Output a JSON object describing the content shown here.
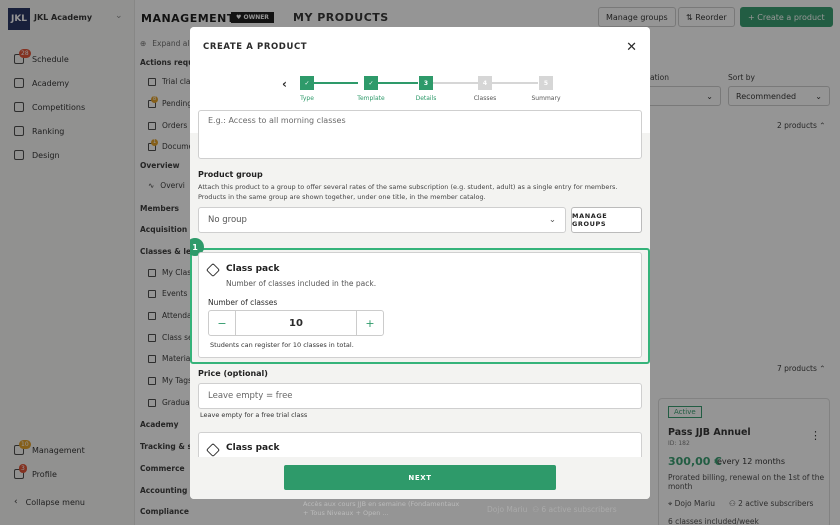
{
  "app": {
    "logo": "JKL",
    "org_name": "JKL Academy"
  },
  "rail": {
    "items": [
      {
        "label": "Schedule",
        "badge": "28"
      },
      {
        "label": "Academy"
      },
      {
        "label": "Competitions"
      },
      {
        "label": "Ranking"
      },
      {
        "label": "Design"
      }
    ],
    "bottom": [
      {
        "label": "Management",
        "badge": "10"
      },
      {
        "label": "Profile",
        "badge": "3"
      },
      {
        "label": "Collapse menu"
      }
    ]
  },
  "col2": {
    "title": "MANAGEMENT",
    "expand": "Expand all",
    "sections": {
      "actions": "Actions requir",
      "overview": "Overview",
      "members": "Members",
      "acquisition": "Acquisition",
      "classes": "Classes & le",
      "academy": "Academy",
      "tracking": "Tracking & st",
      "commerce": "Commerce",
      "accounting": "Accounting &",
      "compliance": "Compliance"
    },
    "actions_items": [
      "Trial cla",
      "Pending",
      "Orders",
      "Docume"
    ],
    "actions_badges": [
      "",
      "8",
      "",
      "1"
    ],
    "overview_items": [
      "Overvi"
    ],
    "classes_items": [
      "My Clas",
      "Events",
      "Attenda",
      "Class se",
      "Materia",
      "My Tags",
      "Gradua"
    ]
  },
  "header": {
    "owner_badge": "OWNER",
    "title": "MY PRODUCTS",
    "manage_groups": "Manage groups",
    "reorder": "Reorder",
    "create_product": "+ Create a product"
  },
  "background": {
    "sort_label": "Sort by",
    "sort_value": "Recommended",
    "filter_label": "ation",
    "products_count_1": "2 products",
    "products_count_2": "7 products",
    "active_badge": "Active",
    "product_name": "Pass JJB Annuel",
    "product_id": "ID: 182",
    "price": "300,00 €",
    "price_period": "every 12 months",
    "billing_note": "Prorated billing, renewal on the 1st of the month",
    "location": "Dojo Mariu",
    "subscribers": "2 active subscribers",
    "classes_included": "6 classes included/week",
    "left_card_text": "Accès aux cours JJB en semaine (Fondamentaux + Tous Niveaux + Open ...",
    "left_card_loc": "Dojo Mariu",
    "left_card_subs": "6 active subscribers"
  },
  "modal": {
    "title": "CREATE A PRODUCT",
    "steps": [
      {
        "label": "Type",
        "state": "done",
        "num": "✓"
      },
      {
        "label": "Template",
        "state": "done",
        "num": "✓"
      },
      {
        "label": "Details",
        "state": "current",
        "num": "3"
      },
      {
        "label": "Classes",
        "state": "todo",
        "num": "4"
      },
      {
        "label": "Summary",
        "state": "todo",
        "num": "5"
      }
    ],
    "description_placeholder": "E.g.: Access to all morning classes",
    "product_group_label": "Product group",
    "product_group_help": "Attach this product to a group to offer several rates of the same subscription (e.g. student, adult) as a single entry for members. Products in the same group are shown together, under one title, in the member catalog.",
    "product_group_value": "No group",
    "manage_groups_btn": "MANAGE GROUPS",
    "highlight_number": "1",
    "pack_title": "Class pack",
    "pack_subtitle": "Number of classes included in the pack.",
    "num_classes_label": "Number of classes",
    "num_classes_value": "10",
    "pack_note": "Students can register for 10 classes in total.",
    "price_label": "Price (optional)",
    "price_placeholder": "Leave empty = free",
    "price_help": "Leave empty for a free trial class",
    "pack_title_2": "Class pack",
    "next_btn": "NEXT"
  },
  "colors": {
    "accent": "#2e9a6a",
    "highlight": "#35b37a",
    "logo_bg": "#1d2a5b"
  }
}
